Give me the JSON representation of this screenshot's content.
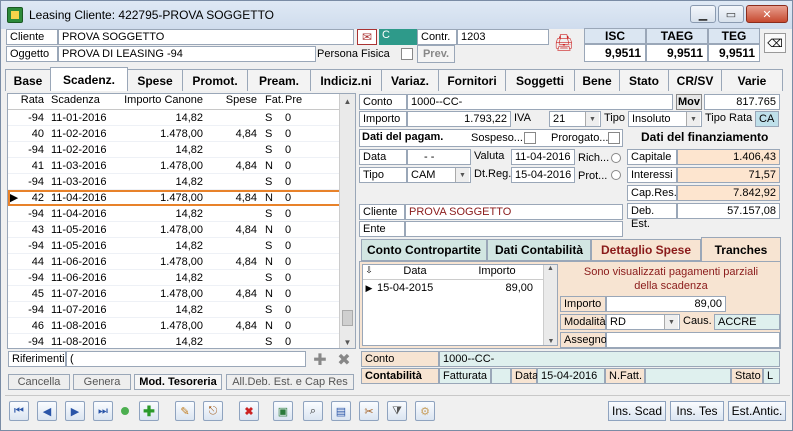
{
  "window": {
    "title": "Leasing Cliente: 422795-PROVA SOGGETTO"
  },
  "header": {
    "cliente_label": "Cliente",
    "cliente_value": "PROVA SOGGETTO",
    "oggetto_label": "Oggetto",
    "oggetto_value": "PROVA DI LEASING -94",
    "c_badge": "C",
    "contr_label": "Contr.",
    "contr_value": "1203",
    "persona_fisica_label": "Persona Fisica",
    "prev_label": "Prev.",
    "isc_label": "ISC",
    "isc_value": "9,9511",
    "taeg_label": "TAEG",
    "taeg_value": "9,9511",
    "teg_label": "TEG",
    "teg_value": "9,9511"
  },
  "tabs": [
    "Base",
    "Scadenz.",
    "Spese",
    "Promot.",
    "Pream.",
    "Indiciz.ni",
    "Variaz.",
    "Fornitori",
    "Soggetti",
    "Bene",
    "Stato",
    "CR/SV",
    "Varie"
  ],
  "grid": {
    "headers": [
      "Rata",
      "Scadenza",
      "Importo Canone",
      "Spese",
      "Fat.",
      "Pre"
    ],
    "rows": [
      {
        "rata": "-94",
        "scad": "11-01-2016",
        "imp": "14,82",
        "spese": "",
        "fat": "S",
        "pre": "0"
      },
      {
        "rata": "40",
        "scad": "11-02-2016",
        "imp": "1.478,00",
        "spese": "4,84",
        "fat": "S",
        "pre": "0"
      },
      {
        "rata": "-94",
        "scad": "11-02-2016",
        "imp": "14,82",
        "spese": "",
        "fat": "S",
        "pre": "0"
      },
      {
        "rata": "41",
        "scad": "11-03-2016",
        "imp": "1.478,00",
        "spese": "4,84",
        "fat": "N",
        "pre": "0"
      },
      {
        "rata": "-94",
        "scad": "11-03-2016",
        "imp": "14,82",
        "spese": "",
        "fat": "S",
        "pre": "0"
      },
      {
        "rata": "42",
        "scad": "11-04-2016",
        "imp": "1.478,00",
        "spese": "4,84",
        "fat": "N",
        "pre": "0"
      },
      {
        "rata": "-94",
        "scad": "11-04-2016",
        "imp": "14,82",
        "spese": "",
        "fat": "S",
        "pre": "0"
      },
      {
        "rata": "43",
        "scad": "11-05-2016",
        "imp": "1.478,00",
        "spese": "4,84",
        "fat": "N",
        "pre": "0"
      },
      {
        "rata": "-94",
        "scad": "11-05-2016",
        "imp": "14,82",
        "spese": "",
        "fat": "S",
        "pre": "0"
      },
      {
        "rata": "44",
        "scad": "11-06-2016",
        "imp": "1.478,00",
        "spese": "4,84",
        "fat": "N",
        "pre": "0"
      },
      {
        "rata": "-94",
        "scad": "11-06-2016",
        "imp": "14,82",
        "spese": "",
        "fat": "S",
        "pre": "0"
      },
      {
        "rata": "45",
        "scad": "11-07-2016",
        "imp": "1.478,00",
        "spese": "4,84",
        "fat": "N",
        "pre": "0"
      },
      {
        "rata": "-94",
        "scad": "11-07-2016",
        "imp": "14,82",
        "spese": "",
        "fat": "S",
        "pre": "0"
      },
      {
        "rata": "46",
        "scad": "11-08-2016",
        "imp": "1.478,00",
        "spese": "4,84",
        "fat": "N",
        "pre": "0"
      },
      {
        "rata": "-94",
        "scad": "11-08-2016",
        "imp": "14,82",
        "spese": "",
        "fat": "S",
        "pre": "0"
      }
    ]
  },
  "riferimenti": {
    "label": "Riferimenti",
    "value": "("
  },
  "bottom_buttons": [
    "Cancella",
    "Genera",
    "Mod. Tesoreria",
    "All.Deb. Est. e Cap Res"
  ],
  "detail": {
    "conto_label": "Conto",
    "conto_value": "1000--CC-",
    "mov_label": "Mov",
    "mov_value": "817.765",
    "importo_label": "Importo",
    "importo_value": "1.793,22",
    "iva_label": "IVA",
    "iva_value": "21",
    "tipo_label": "Tipo",
    "tipo_value": "Insoluto",
    "tipo_rata_label": "Tipo Rata",
    "tipo_rata_value": "CA",
    "pagam_header": "Dati del pagam.",
    "sospeso_label": "Sospeso...",
    "prorogato_label": "Prorogato...",
    "finanz_header": "Dati del finanziamento",
    "data_label": "Data",
    "data_value": "- -",
    "valuta_label": "Valuta",
    "valuta_value": "11-04-2016",
    "rich_label": "Rich...",
    "tipo2_label": "Tipo",
    "tipo2_value": "CAM",
    "dtreg_label": "Dt.Reg.",
    "dtreg_value": "15-04-2016",
    "prot_label": "Prot...",
    "capitale_label": "Capitale",
    "capitale_value": "1.406,43",
    "interessi_label": "Interessi",
    "interessi_value": "71,57",
    "capres_label": "Cap.Res.",
    "capres_value": "7.842,92",
    "debest_label": "Deb. Est.",
    "debest_value": "57.157,08",
    "cliente_label": "Cliente",
    "cliente_value": "PROVA SOGGETTO",
    "ente_label": "Ente",
    "ente_value": ""
  },
  "subtabs": [
    "Conto Contropartite",
    "Dati Contabilità",
    "Dettaglio Spese",
    "Tranches"
  ],
  "tranches": {
    "headers": [
      "Data",
      "Importo"
    ],
    "rows": [
      {
        "data": "15-04-2015",
        "importo": "89,00"
      }
    ],
    "info": "Sono visualizzati pagamenti parziali della scadenza",
    "importo_label": "Importo",
    "importo_value": "89,00",
    "modalita_label": "Modalità",
    "modalita_value": "RD",
    "caus_label": "Caus.",
    "caus_value": "ACCRE",
    "assegno_label": "Assegno",
    "assegno_value": ""
  },
  "footer_detail": {
    "conto_label": "Conto",
    "conto_value": "1000--CC-",
    "contabilita_label": "Contabilità",
    "fatturata_label": "Fatturata",
    "data_label": "Data",
    "data_value": "15-04-2016",
    "nfatt_label": "N.Fatt.",
    "stato_label": "Stato",
    "stato_value": "L"
  },
  "toolbar_right": [
    "Ins. Scad",
    "Ins. Tes",
    "Est.Antic."
  ]
}
